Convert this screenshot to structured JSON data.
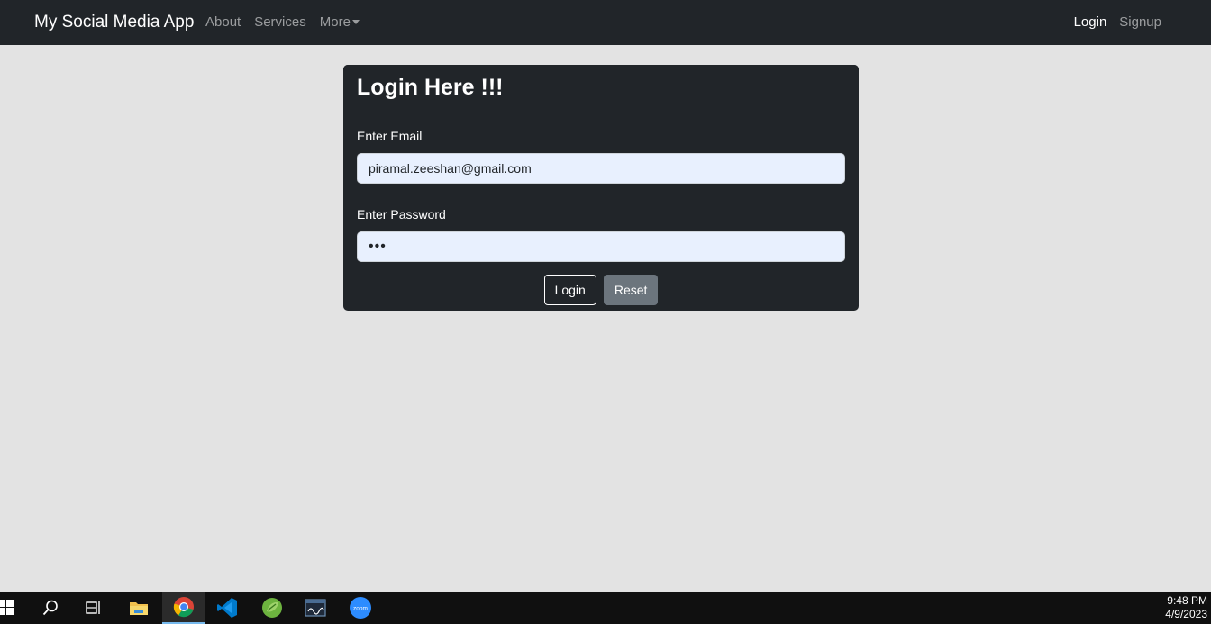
{
  "navbar": {
    "brand": "My Social Media App",
    "left_links": [
      "About",
      "Services",
      "More"
    ],
    "right_links": [
      "Login",
      "Signup"
    ]
  },
  "login_card": {
    "title": "Login Here !!!",
    "email_label": "Enter Email",
    "email_value": "piramal.zeeshan@gmail.com",
    "password_label": "Enter Password",
    "password_value": "•••",
    "login_button": "Login",
    "reset_button": "Reset"
  },
  "taskbar": {
    "icons": [
      "windows-start-icon",
      "search-icon",
      "task-view-icon",
      "file-explorer-icon",
      "chrome-icon",
      "vscode-icon",
      "spring-tool-suite-icon",
      "mysql-workbench-icon",
      "zoom-icon"
    ],
    "zoom_text": "zoom",
    "time": "9:48 PM",
    "date": "4/9/2023"
  },
  "colors": {
    "navbar_bg": "#212529",
    "page_bg": "#e3e3e3",
    "input_bg": "#e8f0fe",
    "reset_btn": "#6c757d"
  }
}
